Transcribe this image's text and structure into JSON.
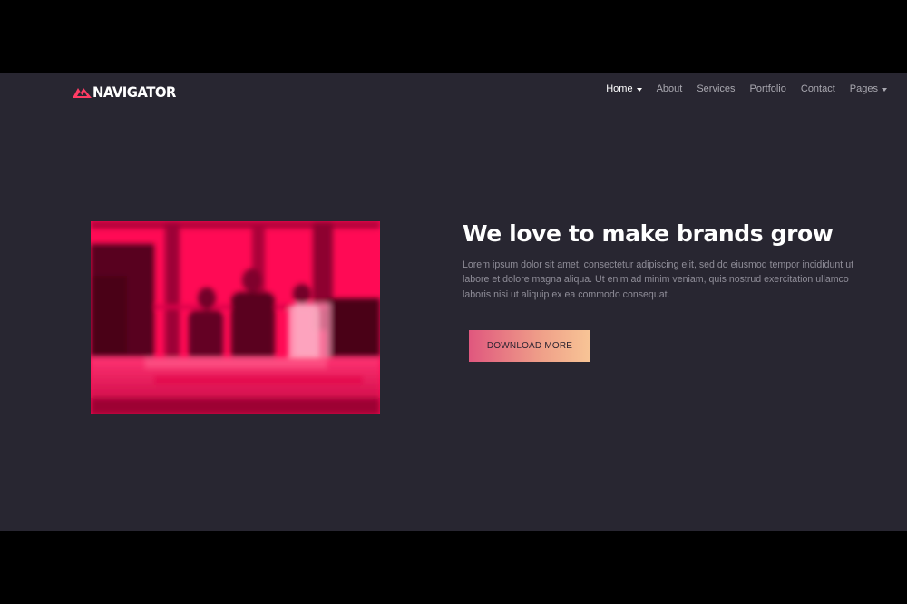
{
  "brand": {
    "name": "NAVIGATOR",
    "logo_icon": "mountain-triangle-logo",
    "logo_color": "#ff3c64"
  },
  "nav": {
    "items": [
      {
        "label": "Home",
        "active": true,
        "dropdown": true
      },
      {
        "label": "About",
        "active": false,
        "dropdown": false
      },
      {
        "label": "Services",
        "active": false,
        "dropdown": false
      },
      {
        "label": "Portfolio",
        "active": false,
        "dropdown": false
      },
      {
        "label": "Contact",
        "active": false,
        "dropdown": false
      },
      {
        "label": "Pages",
        "active": false,
        "dropdown": true
      }
    ]
  },
  "hero": {
    "title": "We love to make brands grow",
    "text": "Lorem ipsum dolor sit amet, consectetur adipiscing elit, sed do eiusmod tempor incididunt ut labore et dolore magna aliqua. Ut enim ad minim veniam, quis nostrud exercitation ullamco laboris nisi ut aliquip ex ea commodo consequat.",
    "button_label": "DOWNLOAD MORE",
    "image_tint": "#ff0a55"
  },
  "colors": {
    "page_background": "#282631",
    "letterbox": "#000000",
    "button_gradient_start": "#e0577e",
    "button_gradient_end": "#f8c596"
  }
}
